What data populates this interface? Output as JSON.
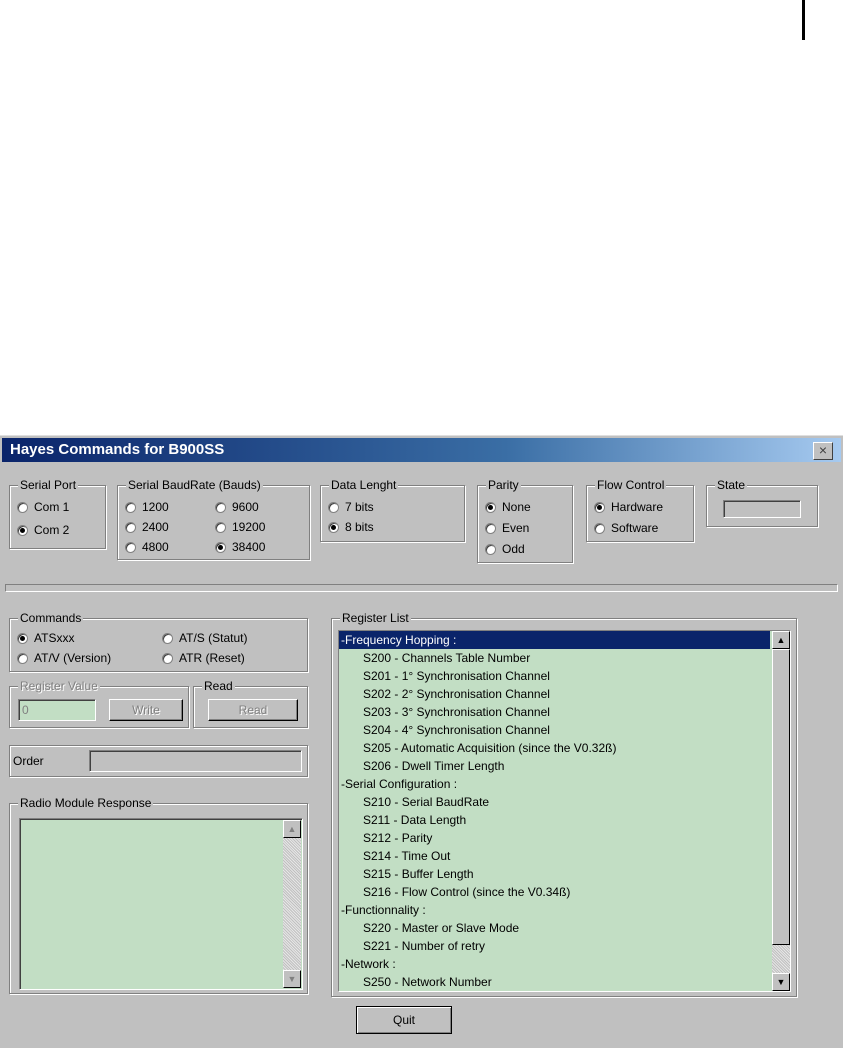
{
  "window": {
    "title": "Hayes Commands for B900SS",
    "close": "×"
  },
  "serial_port": {
    "label": "Serial Port",
    "options": [
      "Com 1",
      "Com 2"
    ],
    "selected": "Com 2"
  },
  "baud": {
    "label": "Serial BaudRate (Bauds)",
    "options": [
      "1200",
      "2400",
      "4800",
      "9600",
      "19200",
      "38400"
    ],
    "selected": "38400"
  },
  "data_length": {
    "label": "Data Lenght",
    "options": [
      "7 bits",
      "8 bits"
    ],
    "selected": "8 bits"
  },
  "parity": {
    "label": "Parity",
    "options": [
      "None",
      "Even",
      "Odd"
    ],
    "selected": "None"
  },
  "flow_control": {
    "label": "Flow Control",
    "options": [
      "Hardware",
      "Software"
    ],
    "selected": "Hardware"
  },
  "state": {
    "label": "State"
  },
  "commands": {
    "label": "Commands",
    "options": [
      "ATSxxx",
      "AT/V (Version)",
      "AT/S (Statut)",
      "ATR (Reset)"
    ],
    "selected": "ATSxxx"
  },
  "register_value": {
    "label": "Register Value",
    "value": "0",
    "write_label": "Write"
  },
  "read": {
    "label": "Read",
    "button_label": "Read"
  },
  "order": {
    "label": "Order",
    "value": ""
  },
  "response": {
    "label": "Radio Module Response"
  },
  "register_list": {
    "label": "Register List",
    "items": [
      "-Frequency Hopping :",
      "S200 - Channels Table Number",
      "S201 - 1° Synchronisation Channel",
      "S202 - 2° Synchronisation Channel",
      "S203 - 3° Synchronisation Channel",
      "S204 - 4° Synchronisation Channel",
      "S205 - Automatic Acquisition (since the V0.32ß)",
      "S206 - Dwell Timer Length",
      "-Serial Configuration :",
      "S210 - Serial BaudRate",
      "S211 - Data Length",
      "S212 - Parity",
      "S214 - Time Out",
      "S215 - Buffer Length",
      "S216 - Flow Control (since the V0.34ß)",
      "-Functionnality :",
      "S220 - Master or Slave Mode",
      "S221 - Number of  retry",
      "-Network :",
      "S250 - Network Number"
    ],
    "selected_index": 0
  },
  "quit": {
    "label": "Quit"
  },
  "colors": {
    "list_bg": "#c2dec4",
    "title_start": "#0a246a",
    "title_end": "#a6caf0",
    "face": "#c0c0c0"
  },
  "icons": {
    "scroll_up": "▲",
    "scroll_down": "▼"
  }
}
